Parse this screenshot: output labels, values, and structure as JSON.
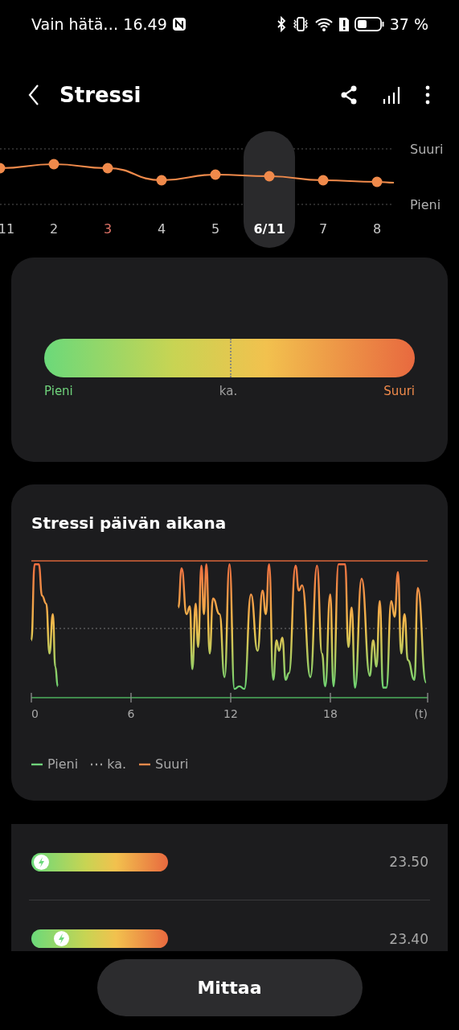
{
  "status_bar": {
    "text": "Vain hätä… 16.49",
    "battery": "37 %"
  },
  "header": {
    "title": "Stressi"
  },
  "trend": {
    "high_label": "Suuri",
    "low_label": "Pieni",
    "days": [
      {
        "label": "11",
        "selected": false,
        "sunday": false
      },
      {
        "label": "2",
        "selected": false,
        "sunday": false
      },
      {
        "label": "3",
        "selected": false,
        "sunday": true
      },
      {
        "label": "4",
        "selected": false,
        "sunday": false
      },
      {
        "label": "5",
        "selected": false,
        "sunday": false
      },
      {
        "label": "6/11",
        "selected": true,
        "sunday": false
      },
      {
        "label": "7",
        "selected": false,
        "sunday": false
      },
      {
        "label": "8",
        "selected": false,
        "sunday": false
      }
    ]
  },
  "range_card": {
    "marker": {
      "level": 0.5
    },
    "labels": [
      {
        "text": "Pieni",
        "kind": "low"
      },
      {
        "text": "ka.",
        "kind": "avg"
      },
      {
        "text": "Suuri",
        "kind": "high"
      }
    ]
  },
  "day_chart": {
    "title": "Stressi päivän aikana",
    "x_ticks": [
      "0",
      "6",
      "12",
      "18",
      "(t)"
    ],
    "legend": [
      {
        "label": "Pieni",
        "kind": "low"
      },
      {
        "label": "ka.",
        "kind": "avg"
      },
      {
        "label": "Suuri",
        "kind": "high"
      }
    ]
  },
  "measurements": [
    {
      "time": "23.50",
      "level": 0
    },
    {
      "time": "23.40",
      "level": 0.17
    }
  ],
  "button": "Mittaa"
}
